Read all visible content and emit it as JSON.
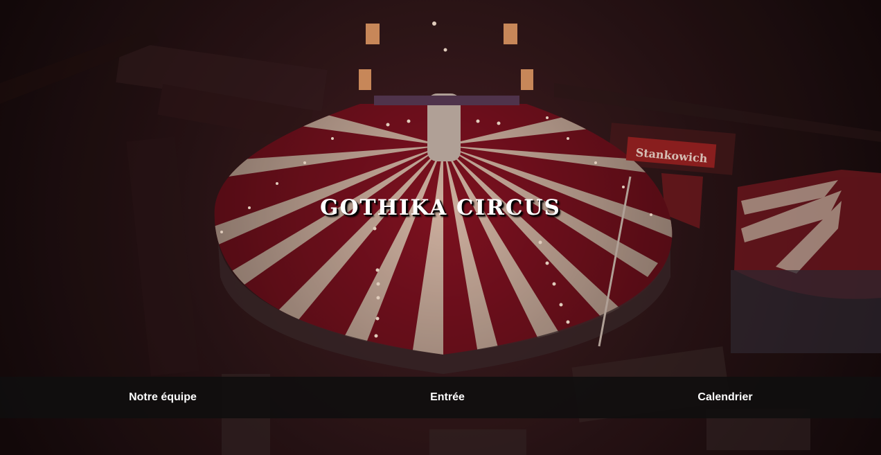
{
  "hero": {
    "title": "GOTHIKA CIRCUS",
    "sign_text": "Stankowich"
  },
  "nav": {
    "items": [
      {
        "label": "Notre équipe"
      },
      {
        "label": "Entrée"
      },
      {
        "label": "Calendrier"
      }
    ]
  },
  "colors": {
    "tent_red": "#8e1424",
    "tent_cream": "#e9c7b4",
    "background_dark": "#1c0e10",
    "nav_bar": "#100e0e",
    "text": "#ffffff"
  }
}
